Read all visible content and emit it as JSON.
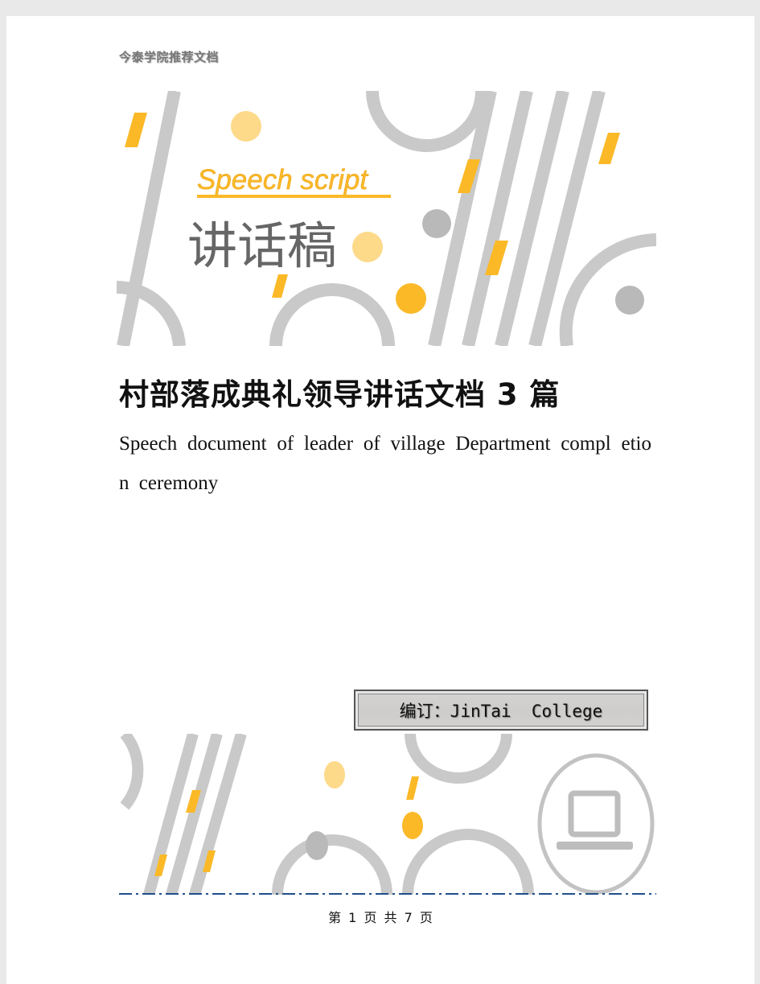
{
  "header": {
    "text": "今泰学院推荐文档"
  },
  "cover": {
    "english_label": "Speech script",
    "chinese_label": "讲话稿",
    "colors": {
      "gray": "#c8c8c8",
      "yellow": "#fbb928",
      "light_yellow": "#fdd98a",
      "dark_gray": "#b9b9b9"
    }
  },
  "document": {
    "title": "村部落成典礼领导讲话文档 3 篇",
    "subtitle": "Speech document of leader of village Department compl etion ceremony"
  },
  "editor": {
    "label": "编订：JinTai  College"
  },
  "footer": {
    "page_text": "第 1 页 共 7 页"
  },
  "divider_color": "#1f4e8a"
}
